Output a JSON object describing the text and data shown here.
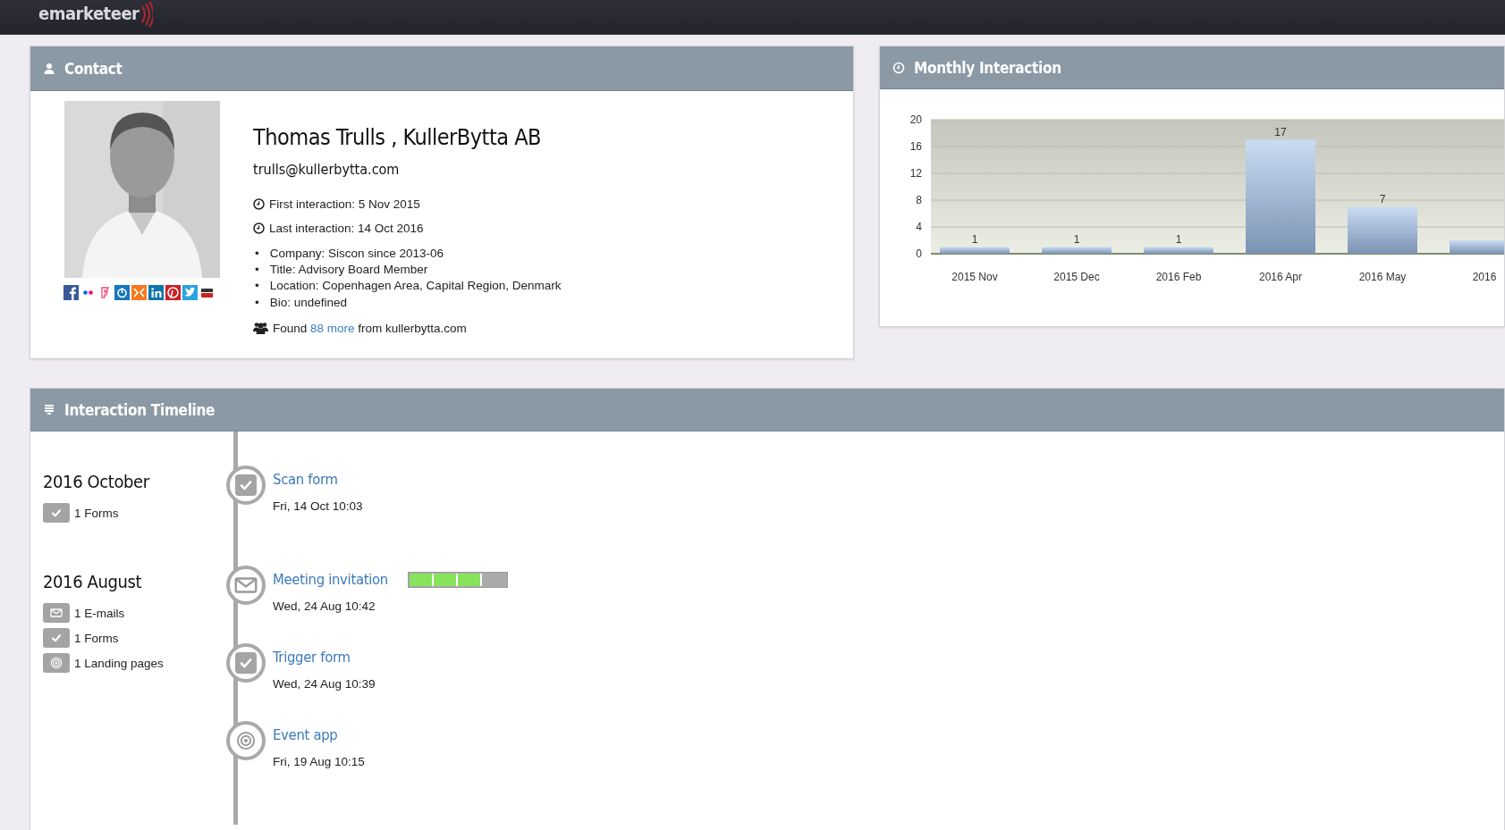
{
  "header": {
    "logo": "emarketeer"
  },
  "contact": {
    "title": "Contact",
    "photo": {
      "kind": "picture"
    },
    "name": "Thomas Trulls , KullerBytta AB",
    "email": "trulls@kullerbytta.com",
    "interactions": [
      "First interaction: 5 Nov 2015",
      "Last interaction: 14 Oct 2016"
    ],
    "details": [
      {
        "bullet": "•",
        "text": "Company: Siscon since 2013-06"
      },
      {
        "bullet": "•",
        "text": "Title: Advisory Board Member"
      },
      {
        "bullet": "•",
        "text": "Location: Copenhagen Area, Capital Region, Denmark"
      },
      {
        "bullet": "•",
        "text": "Bio: undefined"
      }
    ],
    "found": {
      "before": "Found",
      "link": "88 more",
      "after": "from kullerbytta.com"
    }
  },
  "monthly": {
    "title": "Monthly Interaction",
    "chart_data": {
      "type": "bar",
      "categories": [
        "2015 Nov",
        "2015 Dec",
        "2016 Feb",
        "2016 Apr",
        "2016 May",
        "2016"
      ],
      "values": [
        1,
        1,
        1,
        17,
        7,
        2
      ],
      "ylim": [
        0,
        20
      ],
      "yticks": [
        0,
        4,
        8,
        12,
        16,
        20
      ],
      "grid": true,
      "value_labels": [
        "1",
        "1",
        "1",
        "17",
        "7",
        null
      ]
    }
  },
  "timeline": {
    "title": "Interaction Timeline",
    "months": [
      {
        "title": "2016 October",
        "summary": [
          {
            "kind": "form",
            "text": "1 Forms"
          }
        ],
        "events": [
          {
            "kind": "form",
            "title": "Scan form",
            "time": "Fri, 14 Oct 10:03"
          }
        ]
      },
      {
        "title": "2016 August",
        "summary": [
          {
            "kind": "email",
            "text": "1 E-mails"
          },
          {
            "kind": "form",
            "text": "1 Forms"
          },
          {
            "kind": "target",
            "text": "1 Landing pages"
          }
        ],
        "events": [
          {
            "kind": "email",
            "title": "Meeting invitation",
            "time": "Wed, 24 Aug 10:42",
            "level": 0.75
          },
          {
            "kind": "form",
            "title": "Trigger form",
            "time": "Wed, 24 Aug 10:39"
          },
          {
            "kind": "target",
            "title": "Event app",
            "time": "Fri, 19 Aug 10:15"
          }
        ]
      }
    ]
  }
}
